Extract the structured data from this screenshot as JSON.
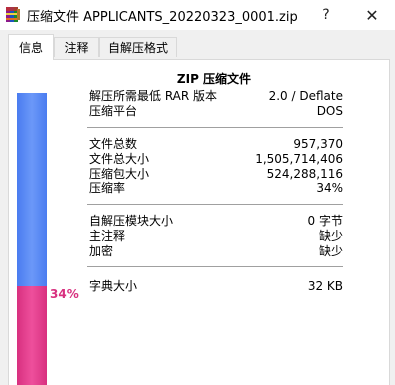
{
  "window": {
    "title": "压缩文件 APPLICANTS_20220323_0001.zip",
    "help_label": "?",
    "close_label": "✕"
  },
  "tabs": [
    {
      "label": "信息"
    },
    {
      "label": "注释"
    },
    {
      "label": "自解压格式"
    }
  ],
  "info": {
    "heading": "ZIP 压缩文件",
    "groups": [
      [
        {
          "label": "解压所需最低 RAR 版本",
          "value": "2.0 / Deflate"
        },
        {
          "label": "压缩平台",
          "value": "DOS"
        }
      ],
      [
        {
          "label": "文件总数",
          "value": "957,370"
        },
        {
          "label": "文件总大小",
          "value": "1,505,714,406"
        },
        {
          "label": "压缩包大小",
          "value": "524,288,116"
        },
        {
          "label": "压缩率",
          "value": "34%"
        }
      ],
      [
        {
          "label": "自解压模块大小",
          "value": "0 字节"
        },
        {
          "label": "主注释",
          "value": "缺少"
        },
        {
          "label": "加密",
          "value": "缺少"
        }
      ],
      [
        {
          "label": "字典大小",
          "value": "32 KB"
        }
      ]
    ]
  },
  "ratio": {
    "label": "34%",
    "fraction": 0.34,
    "colors": {
      "compressed": "#e8388e",
      "remaining": "#5b8cf5"
    }
  },
  "icons": {
    "app": "winrar-archive-icon"
  }
}
